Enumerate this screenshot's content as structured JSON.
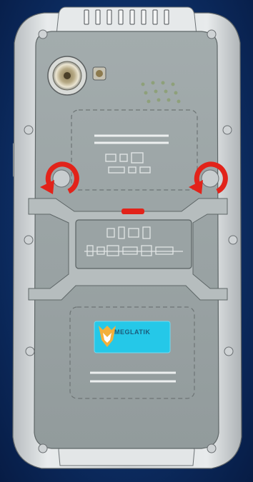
{
  "device": {
    "brand_logo_text": "MEGLATIK"
  },
  "colors": {
    "background": "#0d2f66",
    "body_metal": "#d4d8da",
    "back_panel": "#9aa3a4",
    "arrow_red": "#e2231a",
    "logo_badge": "#25c8e8"
  },
  "annotations": {
    "left_screw_arrow": "counter-clockwise-arrow-icon",
    "right_screw_arrow": "counter-clockwise-arrow-icon"
  }
}
